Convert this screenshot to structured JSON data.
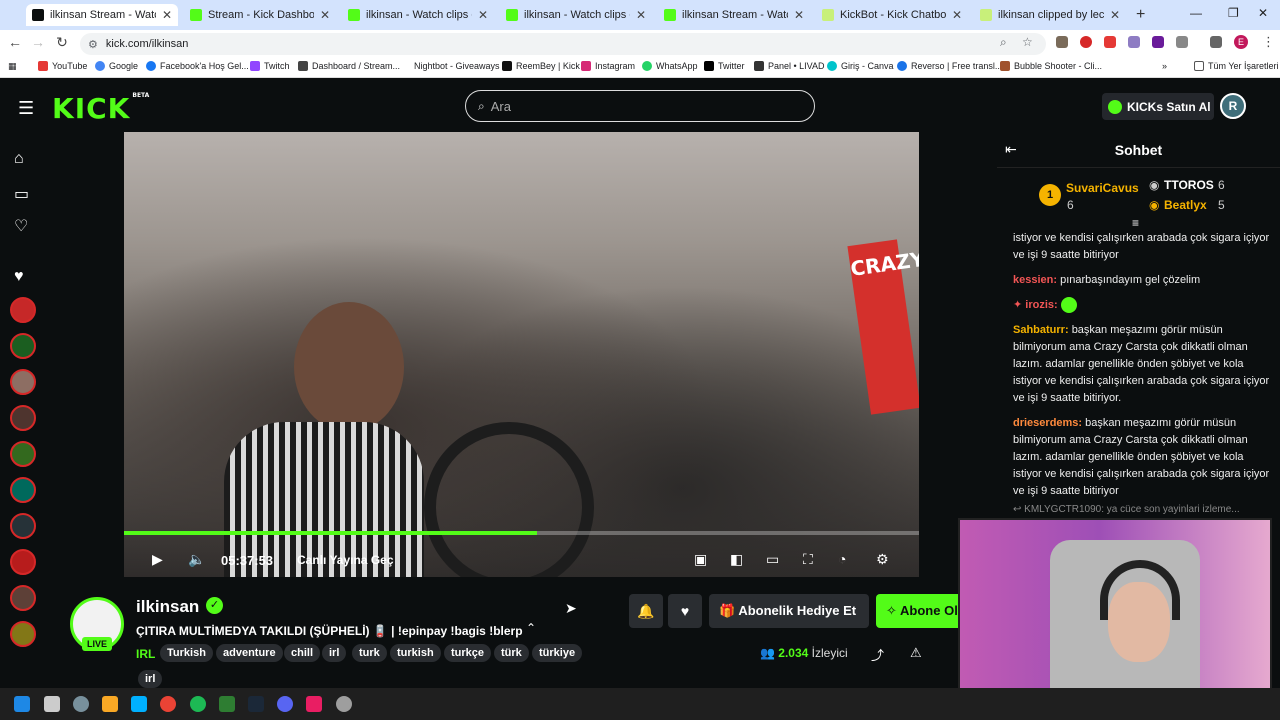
{
  "browser": {
    "tabs": [
      {
        "title": "ilkinsan Stream - Watch Live on Kick",
        "active": true
      },
      {
        "title": "Stream - Kick Dashboard"
      },
      {
        "title": "ilkinsan - Watch clips on Kick"
      },
      {
        "title": "ilkinsan - Watch clips on Kick"
      },
      {
        "title": "ilkinsan Stream - Watch Live on Kick"
      },
      {
        "title": "KickBot - Kick Chatbot, Alerts, T"
      },
      {
        "title": "ilkinsan clipped by leclercurry"
      }
    ],
    "url": "kick.com/ilkinsan",
    "bookmarks": [
      "YouTube",
      "Google",
      "Facebook'a Hoş Gel...",
      "Twitch",
      "Dashboard / Stream...",
      "Nightbot - Giveaways",
      "ReemBey | Kick",
      "Instagram",
      "WhatsApp",
      "Twitter",
      "Panel • LIVAD",
      "Giriş - Canva",
      "Reverso | Free transl...",
      "Bubble Shooter - Cli..."
    ],
    "all_bookmarks": "Tüm Yer İşaretleri",
    "profile_letter": "E"
  },
  "kick": {
    "logo": "KICK",
    "logo_beta": "BETA",
    "search_placeholder": "Ara",
    "kicks_button": "KICKs Satın Al"
  },
  "player": {
    "time": "05:37:53",
    "go_live": "Canlı Yayına Geç",
    "progress": 0.52,
    "overlay_text": "CRAZY"
  },
  "channel": {
    "name": "ilkinsan",
    "live_badge": "LIVE",
    "title": "ÇITIRA MULTİMEDYA TAKILDI (ŞÜPHELİ) 🪫 | !epinpay !bagis !blerp",
    "category": "IRL",
    "tags": [
      "Turkish",
      "adventure",
      "chill",
      "irl",
      "turk",
      "turkish",
      "turkçe",
      "türk",
      "türkiye",
      "irl"
    ],
    "gift_button": "Abonelik Hediye Et",
    "subscribe_button": "Abone Ol",
    "viewer_count": "2.034",
    "viewer_label": "İzleyici"
  },
  "chat": {
    "title": "Sohbet",
    "leaderboard": [
      {
        "rank": "1",
        "name": "SuvariCavus",
        "count": "6",
        "color": "#f5b300"
      },
      {
        "name": "TTOROS",
        "count": "6",
        "color": "#ffffff"
      },
      {
        "name": "Beatlyx",
        "count": "5",
        "color": "#f5b300"
      }
    ],
    "messages": [
      {
        "user": "",
        "text": "istiyor ve kendisi çalışırken arabada çok sigara içiyor ve işi 9 saatte bitiriyor",
        "color": "#ffffff"
      },
      {
        "user": "kessien:",
        "text": "pınarbaşındayım gel çözelim",
        "color": "#f25555"
      },
      {
        "user": "irozis:",
        "text": "",
        "color": "#f25555"
      },
      {
        "user": "Sahbaturr:",
        "text": "başkan meşazımı görür müsün bilmiyorum ama Crazy Carsta çok dikkatli olman lazım. adamlar genellikle önden şöbiyet ve kola istiyor ve kendisi çalışırken arabada çok sigara içiyor ve işi 9 saatte bitiriyor.",
        "color": "#f5b300"
      },
      {
        "user": "drieserdems:",
        "text": "başkan meşazımı görür müsün bilmiyorum ama Crazy Carsta çok dikkatli olman lazım. adamlar genellikle önden şöbiyet ve kola istiyor ve kendisi çalışırken arabada çok sigara içiyor ve işi 9 saatte bitiriyor",
        "color": "#ff8a3d"
      }
    ],
    "reply_preview": "KMLYGCTR1090: ya cüce son yayinlari izleme..."
  },
  "colors": {
    "accent": "#53fc18",
    "background": "#0b0e0f",
    "button_dark": "#2a2d31"
  }
}
